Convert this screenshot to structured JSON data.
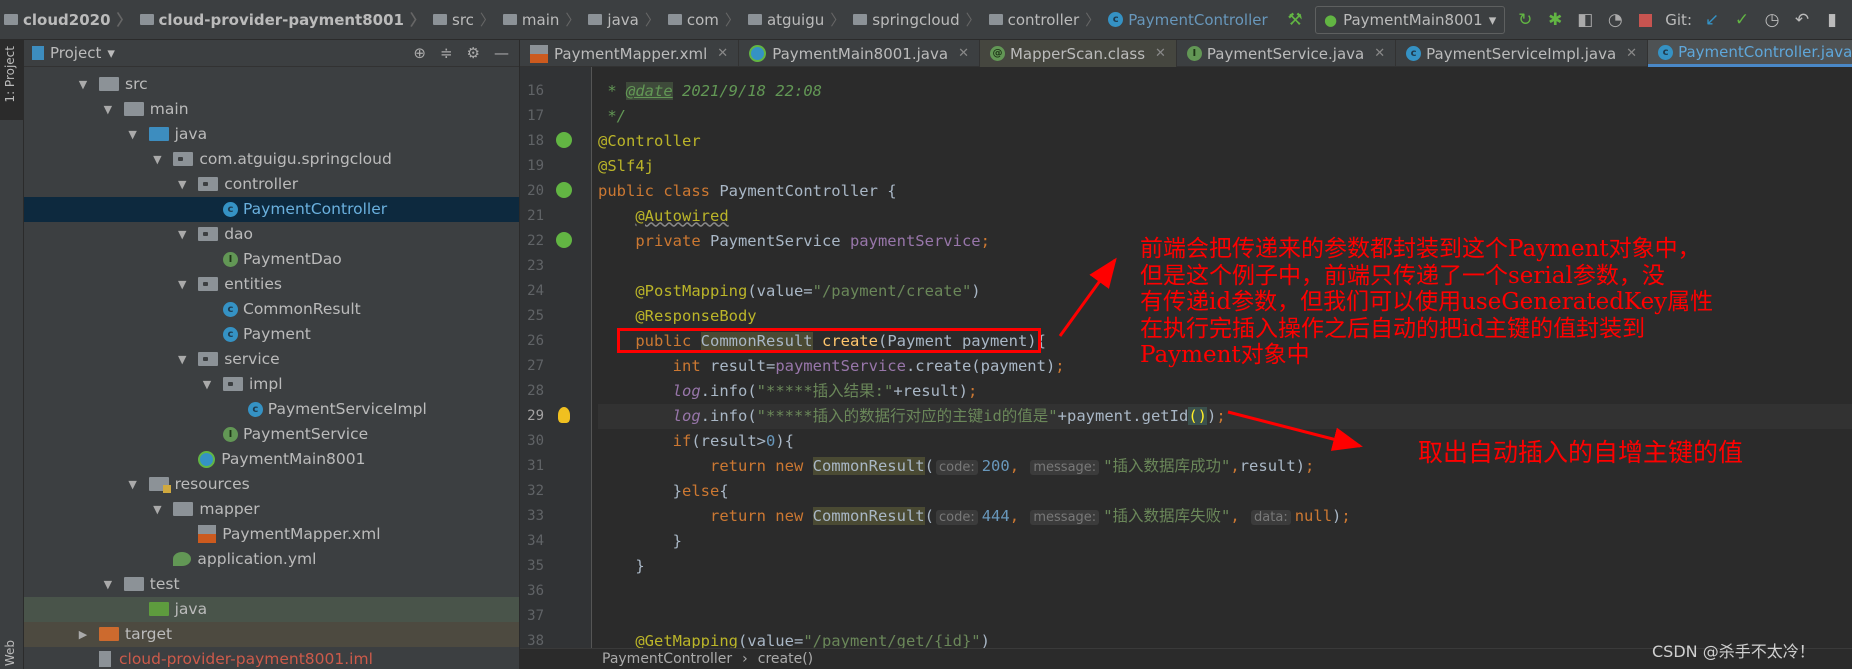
{
  "nav": {
    "crumbs": [
      {
        "label": "cloud2020",
        "type": "bold"
      },
      {
        "label": "cloud-provider-payment8001",
        "type": "bold"
      },
      {
        "label": "src"
      },
      {
        "label": "main"
      },
      {
        "label": "java"
      },
      {
        "label": "com"
      },
      {
        "label": "atguigu"
      },
      {
        "label": "springcloud"
      },
      {
        "label": "controller"
      },
      {
        "label": "PaymentController",
        "type": "cls"
      }
    ],
    "run_config": "PaymentMain8001",
    "git_label": "Git:"
  },
  "side_tabs": {
    "project": "1: Project",
    "web": "Web"
  },
  "project": {
    "title": "Project",
    "tree": [
      {
        "label": "src",
        "depth": 0,
        "arrow": "open",
        "icon": "folder"
      },
      {
        "label": "main",
        "depth": 1,
        "arrow": "open",
        "icon": "folder"
      },
      {
        "label": "java",
        "depth": 2,
        "arrow": "open",
        "icon": "folder-src"
      },
      {
        "label": "com.atguigu.springcloud",
        "depth": 3,
        "arrow": "open",
        "icon": "package"
      },
      {
        "label": "controller",
        "depth": 4,
        "arrow": "open",
        "icon": "package"
      },
      {
        "label": "PaymentController",
        "depth": 5,
        "arrow": "",
        "icon": "class",
        "selected": true
      },
      {
        "label": "dao",
        "depth": 4,
        "arrow": "open",
        "icon": "package"
      },
      {
        "label": "PaymentDao",
        "depth": 5,
        "arrow": "",
        "icon": "interface"
      },
      {
        "label": "entities",
        "depth": 4,
        "arrow": "open",
        "icon": "package"
      },
      {
        "label": "CommonResult",
        "depth": 5,
        "arrow": "",
        "icon": "class"
      },
      {
        "label": "Payment",
        "depth": 5,
        "arrow": "",
        "icon": "class"
      },
      {
        "label": "service",
        "depth": 4,
        "arrow": "open",
        "icon": "package"
      },
      {
        "label": "impl",
        "depth": 5,
        "arrow": "open",
        "icon": "package"
      },
      {
        "label": "PaymentServiceImpl",
        "depth": 6,
        "arrow": "",
        "icon": "class"
      },
      {
        "label": "PaymentService",
        "depth": 5,
        "arrow": "",
        "icon": "interface"
      },
      {
        "label": "PaymentMain8001",
        "depth": 4,
        "arrow": "",
        "icon": "spring-class"
      },
      {
        "label": "resources",
        "depth": 2,
        "arrow": "open",
        "icon": "folder-resources"
      },
      {
        "label": "mapper",
        "depth": 3,
        "arrow": "open",
        "icon": "folder"
      },
      {
        "label": "PaymentMapper.xml",
        "depth": 4,
        "arrow": "",
        "icon": "xml"
      },
      {
        "label": "application.yml",
        "depth": 3,
        "arrow": "",
        "icon": "yml"
      },
      {
        "label": "test",
        "depth": 1,
        "arrow": "open",
        "icon": "folder"
      },
      {
        "label": "java",
        "depth": 2,
        "arrow": "",
        "icon": "folder-test",
        "highlight": "test"
      },
      {
        "label": "target",
        "depth": 0,
        "arrow": "closed",
        "icon": "folder-target",
        "highlight": "target"
      },
      {
        "label": "cloud-provider-payment8001.iml",
        "depth": 0,
        "arrow": "",
        "icon": "iml",
        "color": "#cc5a4a"
      }
    ]
  },
  "tabs": [
    {
      "label": "PaymentMapper.xml",
      "icon": "xml"
    },
    {
      "label": "PaymentMain8001.java",
      "icon": "spring-class"
    },
    {
      "label": "MapperScan.class",
      "icon": "annotation",
      "dim": true
    },
    {
      "label": "PaymentService.java",
      "icon": "interface"
    },
    {
      "label": "PaymentServiceImpl.java",
      "icon": "class"
    },
    {
      "label": "PaymentController.java",
      "icon": "class",
      "active": true
    }
  ],
  "code": [
    {
      "n": 16,
      "t": [
        [
          " * ",
          "c"
        ],
        [
          "@date",
          "tagc"
        ],
        [
          " 2021/9/18 22:08",
          "c"
        ]
      ]
    },
    {
      "n": 17,
      "t": [
        [
          " */",
          "c"
        ]
      ]
    },
    {
      "n": 18,
      "t": [
        [
          "@Controller",
          "a"
        ]
      ],
      "g": "bean"
    },
    {
      "n": 19,
      "t": [
        [
          "@Slf4j",
          "a"
        ]
      ]
    },
    {
      "n": 20,
      "t": [
        [
          "public class ",
          "k"
        ],
        [
          "PaymentController {",
          ""
        ]
      ],
      "g": "bean"
    },
    {
      "n": 21,
      "t": [
        [
          "    ",
          ""
        ],
        [
          "@Autowired",
          "a u"
        ]
      ]
    },
    {
      "n": 22,
      "t": [
        [
          "    ",
          ""
        ],
        [
          "private ",
          "k"
        ],
        [
          "PaymentService ",
          ""
        ],
        [
          "paymentService",
          "f"
        ],
        [
          ";",
          "k"
        ]
      ],
      "g": "bean"
    },
    {
      "n": 23,
      "t": []
    },
    {
      "n": 24,
      "t": [
        [
          "    ",
          ""
        ],
        [
          "@PostMapping",
          "a"
        ],
        [
          "(value=",
          ""
        ],
        [
          "\"/payment/create\"",
          "s"
        ],
        [
          ")",
          ""
        ]
      ]
    },
    {
      "n": 25,
      "t": [
        [
          "    ",
          ""
        ],
        [
          "@ResponseBody",
          "a"
        ]
      ]
    },
    {
      "n": 26,
      "t": [
        [
          "    ",
          ""
        ],
        [
          "public ",
          "k"
        ],
        [
          "CommonResult",
          "hl"
        ],
        [
          " ",
          ""
        ],
        [
          "create",
          "m"
        ],
        [
          "(Payment payment){",
          ""
        ]
      ]
    },
    {
      "n": 27,
      "t": [
        [
          "        ",
          ""
        ],
        [
          "int ",
          "k"
        ],
        [
          "result=",
          ""
        ],
        [
          "paymentService",
          "f"
        ],
        [
          ".create(payment)",
          ""
        ],
        [
          ";",
          "k"
        ]
      ]
    },
    {
      "n": 28,
      "t": [
        [
          "        ",
          ""
        ],
        [
          "log",
          "it"
        ],
        [
          ".info(",
          ""
        ],
        [
          "\"*****插入结果:\"",
          "s"
        ],
        [
          "+result)",
          ""
        ],
        [
          ";",
          "k"
        ]
      ]
    },
    {
      "n": 29,
      "t": [
        [
          "        ",
          ""
        ],
        [
          "log",
          "it"
        ],
        [
          ".info(",
          ""
        ],
        [
          "\"*****插入的数据行对应的主键id的值是\"",
          "s"
        ],
        [
          "+payment.getId",
          ""
        ],
        [
          "()",
          "brm"
        ],
        [
          ")",
          ""
        ],
        [
          ";",
          "k"
        ]
      ],
      "cur": true,
      "g": "bulb"
    },
    {
      "n": 30,
      "t": [
        [
          "        ",
          ""
        ],
        [
          "if",
          "k"
        ],
        [
          "(result>",
          ""
        ],
        [
          "0",
          "n"
        ],
        [
          "){",
          ""
        ]
      ]
    },
    {
      "n": 31,
      "t": [
        [
          "            ",
          ""
        ],
        [
          "return new ",
          "k"
        ],
        [
          "CommonResult",
          "hl"
        ],
        [
          "(",
          ""
        ],
        [
          "code:",
          "h"
        ],
        [
          "200",
          "n"
        ],
        [
          ", ",
          "k"
        ],
        [
          "message:",
          "h"
        ],
        [
          "\"插入数据库成功\"",
          "s"
        ],
        [
          ",",
          "k"
        ],
        [
          "result)",
          ""
        ],
        [
          ";",
          "k"
        ]
      ]
    },
    {
      "n": 32,
      "t": [
        [
          "        }",
          ""
        ],
        [
          "else",
          "k"
        ],
        [
          "{",
          ""
        ]
      ]
    },
    {
      "n": 33,
      "t": [
        [
          "            ",
          ""
        ],
        [
          "return new ",
          "k"
        ],
        [
          "CommonResult",
          "hl"
        ],
        [
          "(",
          ""
        ],
        [
          "code:",
          "h"
        ],
        [
          "444",
          "n"
        ],
        [
          ", ",
          "k"
        ],
        [
          "message:",
          "h"
        ],
        [
          "\"插入数据库失败\"",
          "s"
        ],
        [
          ", ",
          "k"
        ],
        [
          "data:",
          "h"
        ],
        [
          "null",
          "k"
        ],
        [
          ")",
          ""
        ],
        [
          ";",
          "k"
        ]
      ]
    },
    {
      "n": 34,
      "t": [
        [
          "        }",
          ""
        ]
      ]
    },
    {
      "n": 35,
      "t": [
        [
          "    }",
          ""
        ]
      ]
    },
    {
      "n": 36,
      "t": []
    },
    {
      "n": 37,
      "t": []
    },
    {
      "n": 38,
      "t": [
        [
          "    ",
          ""
        ],
        [
          "@GetMapping",
          "a"
        ],
        [
          "(value=",
          ""
        ],
        [
          "\"/payment/get/{id}\"",
          "s"
        ],
        [
          ")",
          ""
        ]
      ]
    }
  ],
  "status": {
    "crumbs": [
      "PaymentController",
      "create()"
    ]
  },
  "annotations": {
    "note1": [
      "前端会把传递来的参数都封装到这个Payment对象中，",
      "但是这个例子中，前端只传递了一个serial参数，没",
      "有传递id参数，但我们可以使用useGeneratedKey属性",
      "在执行完插入操作之后自动的把id主键的值封装到",
      "Payment对象中"
    ],
    "note2": "取出自动插入的自增主键的值",
    "color": "#ff0000"
  },
  "watermark": "CSDN @杀手不太冷！"
}
